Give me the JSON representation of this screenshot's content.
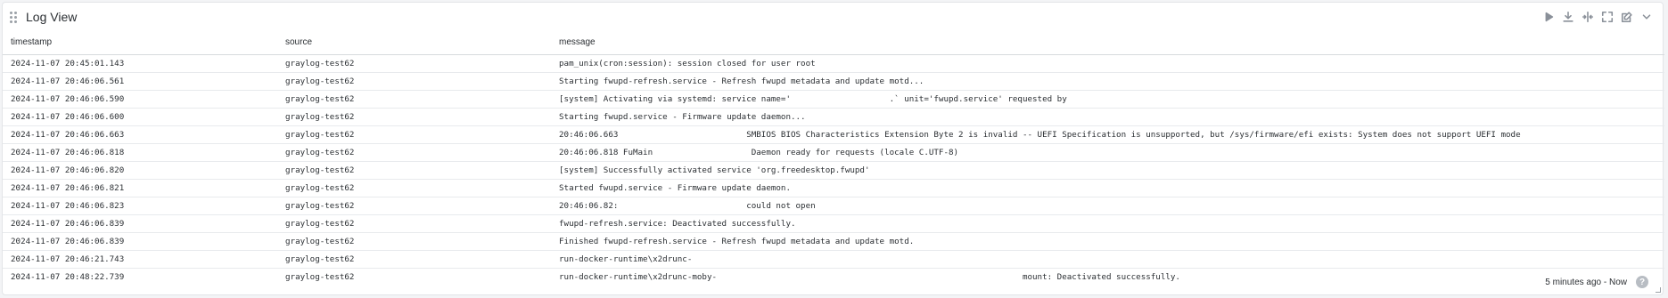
{
  "widget": {
    "title": "Log View",
    "footer_range": "5 minutes ago - Now",
    "help_glyph": "?"
  },
  "icons": {
    "drag": "drag-handle-icon",
    "play": "play-icon",
    "export": "download-icon",
    "compare": "split-icon",
    "focus": "expand-icon",
    "edit": "edit-icon",
    "menu": "chevron-down-icon"
  },
  "table": {
    "columns": [
      "timestamp",
      "source",
      "message"
    ],
    "rows": [
      {
        "timestamp": "2024-11-07 20:45:01.143",
        "source": "graylog-test62",
        "message": "pam_unix(cron:session): session closed for user root"
      },
      {
        "timestamp": "2024-11-07 20:46:06.561",
        "source": "graylog-test62",
        "message": "Starting fwupd-refresh.service - Refresh fwupd metadata and update motd..."
      },
      {
        "timestamp": "2024-11-07 20:46:06.590",
        "source": "graylog-test62",
        "message": "[system] Activating via systemd: service name='                    .` unit='fwupd.service' requested by"
      },
      {
        "timestamp": "2024-11-07 20:46:06.600",
        "source": "graylog-test62",
        "message": "Starting fwupd.service - Firmware update daemon..."
      },
      {
        "timestamp": "2024-11-07 20:46:06.663",
        "source": "graylog-test62",
        "message": "20:46:06.663                          SMBIOS BIOS Characteristics Extension Byte 2 is invalid -- UEFI Specification is unsupported, but /sys/firmware/efi exists: System does not support UEFI mode"
      },
      {
        "timestamp": "2024-11-07 20:46:06.818",
        "source": "graylog-test62",
        "message": "20:46:06.818 FuMain                    Daemon ready for requests (locale C.UTF-8)"
      },
      {
        "timestamp": "2024-11-07 20:46:06.820",
        "source": "graylog-test62",
        "message": "[system] Successfully activated service 'org.freedesktop.fwupd'"
      },
      {
        "timestamp": "2024-11-07 20:46:06.821",
        "source": "graylog-test62",
        "message": "Started fwupd.service - Firmware update daemon."
      },
      {
        "timestamp": "2024-11-07 20:46:06.823",
        "source": "graylog-test62",
        "message": "20:46:06.82:                          could not open"
      },
      {
        "timestamp": "2024-11-07 20:46:06.839",
        "source": "graylog-test62",
        "message": "fwupd-refresh.service: Deactivated successfully."
      },
      {
        "timestamp": "2024-11-07 20:46:06.839",
        "source": "graylog-test62",
        "message": "Finished fwupd-refresh.service - Refresh fwupd metadata and update motd."
      },
      {
        "timestamp": "2024-11-07 20:46:21.743",
        "source": "graylog-test62",
        "message": "run-docker-runtime\\x2drunc-"
      },
      {
        "timestamp": "2024-11-07 20:48:22.739",
        "source": "graylog-test62",
        "message": "run-docker-runtime\\x2drunc-moby-                                                              mount: Deactivated successfully."
      }
    ]
  }
}
